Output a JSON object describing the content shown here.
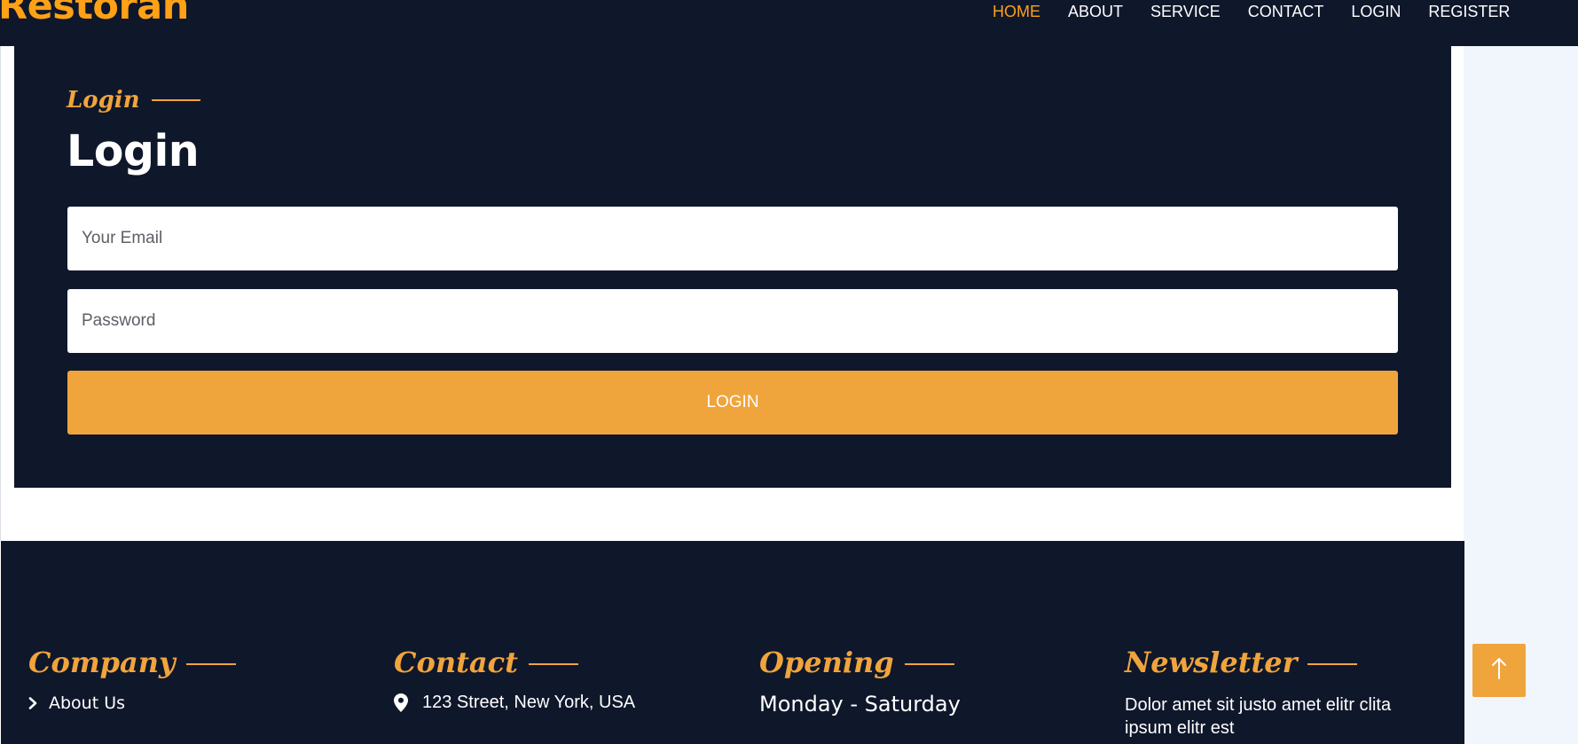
{
  "brand": "Restoran",
  "nav": {
    "items": [
      {
        "label": "HOME",
        "active": true
      },
      {
        "label": "ABOUT",
        "active": false
      },
      {
        "label": "SERVICE",
        "active": false
      },
      {
        "label": "CONTACT",
        "active": false
      },
      {
        "label": "LOGIN",
        "active": false
      },
      {
        "label": "REGISTER",
        "active": false
      }
    ]
  },
  "login": {
    "subtitle": "Login",
    "title": "Login",
    "email_placeholder": "Your Email",
    "password_placeholder": "Password",
    "button_label": "LOGIN"
  },
  "footer": {
    "company": {
      "heading": "Company",
      "first_link": "About Us"
    },
    "contact": {
      "heading": "Contact",
      "address": "123 Street, New York, USA"
    },
    "opening": {
      "heading": "Opening",
      "days": "Monday - Saturday"
    },
    "newsletter": {
      "heading": "Newsletter",
      "text": "Dolor amet sit justo amet elitr clita ipsum elitr est"
    }
  },
  "colors": {
    "navy": "#0f172b",
    "accent": "#f0a43c",
    "nav_active": "#fea116",
    "side_background": "#f1f6fd"
  },
  "icons": {
    "footer_link": "chevron-right-icon",
    "address": "map-pin-icon",
    "back_to_top": "arrow-up-icon"
  }
}
